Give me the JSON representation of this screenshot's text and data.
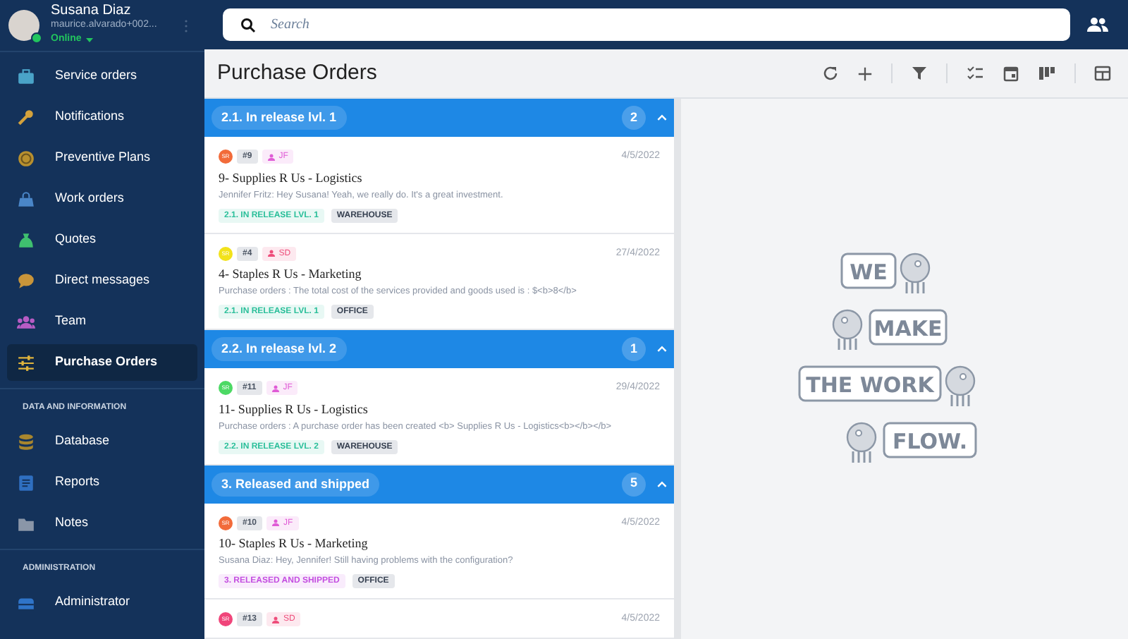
{
  "user": {
    "name": "Susana Diaz",
    "email": "maurice.alvarado+002...",
    "status": "Online",
    "online": true
  },
  "sidebar": {
    "sections": [
      {
        "items": [
          {
            "label": "Service orders",
            "kind": "briefcase",
            "color": "#4aa3c8",
            "selected": false
          },
          {
            "label": "Notifications",
            "kind": "wrench",
            "color": "#d4a23c",
            "selected": false
          },
          {
            "label": "Preventive Plans",
            "kind": "clock",
            "color": "#b8902e",
            "selected": false
          },
          {
            "label": "Work orders",
            "kind": "bag",
            "color": "#4a86c8",
            "selected": false
          },
          {
            "label": "Quotes",
            "kind": "sack",
            "color": "#3fbf6f",
            "selected": false
          },
          {
            "label": "Direct messages",
            "kind": "chat",
            "color": "#c9953a",
            "selected": false
          },
          {
            "label": "Team",
            "kind": "people",
            "color": "#b75cc4",
            "selected": false
          },
          {
            "label": "Purchase Orders",
            "kind": "sliders",
            "color": "#e0b43c",
            "selected": true
          }
        ]
      },
      {
        "title": "DATA AND INFORMATION",
        "items": [
          {
            "label": "Database",
            "kind": "database",
            "color": "#a8862e",
            "selected": false
          },
          {
            "label": "Reports",
            "kind": "document",
            "color": "#2f6fc0",
            "selected": false
          },
          {
            "label": "Notes",
            "kind": "folder",
            "color": "#8a96a8",
            "selected": false
          }
        ]
      },
      {
        "title": "ADMINISTRATION",
        "items": [
          {
            "label": "Administrator",
            "kind": "toolbox",
            "color": "#2f74c8",
            "selected": false
          }
        ]
      }
    ]
  },
  "search": {
    "placeholder": "Search"
  },
  "page_title": "Purchase Orders",
  "groups": [
    {
      "title": "2.1. In release lvl. 1",
      "count": "2",
      "expanded": true,
      "cards": [
        {
          "initials": "SR",
          "color": "#f26b3a",
          "number": "#9",
          "assignee": {
            "initials": "JF",
            "color": "#e05bd6"
          },
          "date": "4/5/2022",
          "title": "9- Supplies R Us - Logistics",
          "message": "Jennifer Fritz: Hey Susana! Yeah, we really do. It's a great investment.",
          "status": {
            "label": "2.1. IN RELEASE LVL. 1",
            "color": "#2bbf9a"
          },
          "category": "WAREHOUSE"
        },
        {
          "initials": "SR",
          "color": "#f2e21a",
          "number": "#4",
          "assignee": {
            "initials": "SD",
            "color": "#ee4d7a"
          },
          "date": "27/4/2022",
          "title": "4- Staples R Us - Marketing",
          "message": "Purchase orders : The total cost of the services provided and goods used is : $<b>8</b>",
          "status": {
            "label": "2.1. IN RELEASE LVL. 1",
            "color": "#2bbf9a"
          },
          "category": "OFFICE"
        }
      ]
    },
    {
      "title": "2.2. In release lvl. 2",
      "count": "1",
      "expanded": true,
      "cards": [
        {
          "initials": "SR",
          "color": "#4cd964",
          "number": "#11",
          "assignee": {
            "initials": "JF",
            "color": "#e05bd6"
          },
          "date": "29/4/2022",
          "title": "11- Supplies R Us - Logistics",
          "message": "Purchase orders : A purchase order has been created <b> Supplies R Us - Logistics<b></b></b>",
          "status": {
            "label": "2.2. IN RELEASE LVL. 2",
            "color": "#2bbf9a"
          },
          "category": "WAREHOUSE"
        }
      ]
    },
    {
      "title": "3. Released and shipped",
      "count": "5",
      "expanded": true,
      "cards": [
        {
          "initials": "SR",
          "color": "#f26b3a",
          "number": "#10",
          "assignee": {
            "initials": "JF",
            "color": "#e05bd6"
          },
          "date": "4/5/2022",
          "title": "10- Staples R Us - Marketing",
          "message": "Susana Diaz: Hey, Jennifer! Still having problems with the configuration?",
          "status": {
            "label": "3. RELEASED AND SHIPPED",
            "color": "#c44ee0"
          },
          "category": "OFFICE"
        },
        {
          "initials": "SR",
          "color": "#f0457a",
          "number": "#13",
          "assignee": {
            "initials": "SD",
            "color": "#ee4d7a"
          },
          "date": "4/5/2022"
        }
      ]
    }
  ],
  "illustration": {
    "bubbles": [
      "WE",
      "MAKE",
      "THE WORK",
      "FLOW."
    ]
  }
}
